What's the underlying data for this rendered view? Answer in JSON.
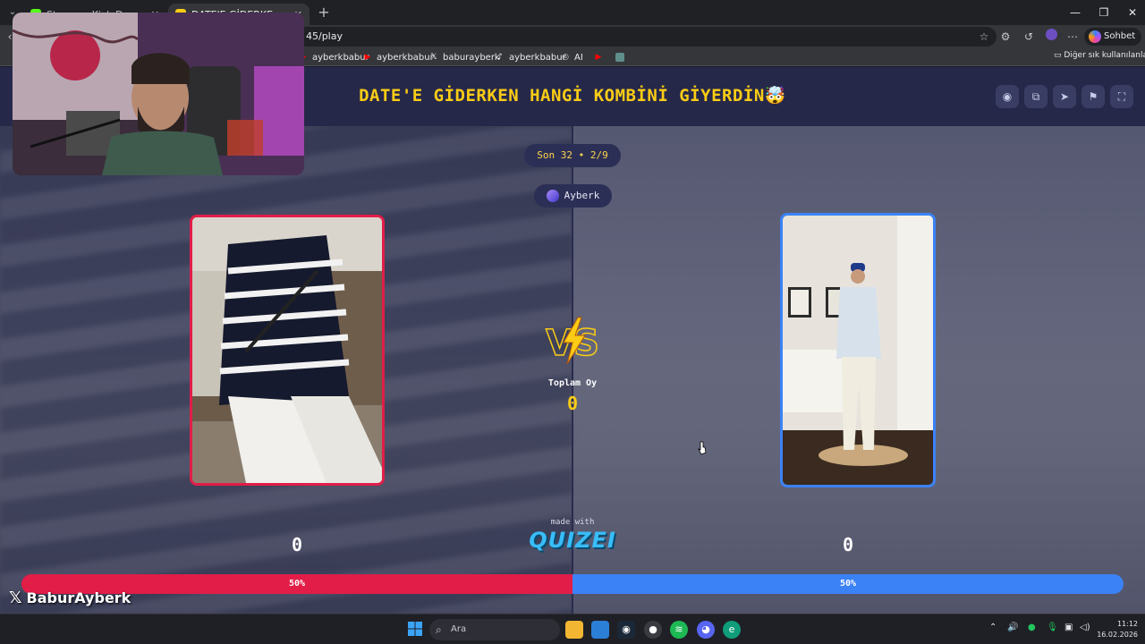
{
  "browser": {
    "tabs": [
      {
        "label": "Stream - Kick Dashboard",
        "active": false,
        "favicon_color": "#53fc18"
      },
      {
        "label": "DATE'E GİDERKEN HANGİ KOMBİNİ",
        "active": true,
        "favicon_color": "#facc15"
      }
    ],
    "new_tab_icon": "plus-icon",
    "url": "45/play",
    "chat_label": "Sohbet et",
    "bookmarks": [
      {
        "label": "ayberkbabur",
        "icon": "youtube-icon",
        "color": "#ff0000"
      },
      {
        "label": "ayberkbabur",
        "icon": "youtube-icon",
        "color": "#ff0000"
      },
      {
        "label": "baburayberk",
        "icon": "x-icon",
        "color": "#ffffff"
      },
      {
        "label": "ayberkbabur",
        "icon": "tiktok-icon",
        "color": "#ffffff"
      },
      {
        "label": "AI",
        "icon": "ai-icon",
        "color": "#cccccc"
      }
    ],
    "other_bookmarks": "Diğer sık kullanılanlar"
  },
  "quiz": {
    "title": "DATE'E GİDERKEN HANGİ KOMBİNİ GİYERDİN🤯",
    "round": "Son 32 • 2/9",
    "player": "Ayberk",
    "vs_label": "VS",
    "total_label": "Toplam Oy",
    "total_value": "0",
    "left": {
      "score": "0",
      "percent_label": "50%",
      "border_color": "#e11d48"
    },
    "right": {
      "score": "0",
      "percent_label": "50%",
      "border_color": "#3b82f6"
    },
    "made_with": "made with",
    "brand": "QUIZEI",
    "vote_split": 0.5,
    "header_buttons": [
      "eye-icon",
      "share-icon",
      "send-icon",
      "flag-icon",
      "fullscreen-icon"
    ]
  },
  "overlay": {
    "handle": "BaburAyberk"
  },
  "taskbar": {
    "search_placeholder": "Ara",
    "time": "11:12",
    "date": "16.02.2026"
  }
}
